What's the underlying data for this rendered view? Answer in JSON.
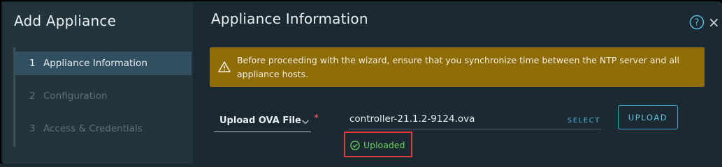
{
  "sidebar": {
    "title": "Add Appliance",
    "steps": [
      {
        "num": "1",
        "label": "Appliance Information"
      },
      {
        "num": "2",
        "label": "Configuration"
      },
      {
        "num": "3",
        "label": "Access & Credentials"
      }
    ]
  },
  "main": {
    "title": "Appliance Information",
    "help_icon": "help-icon",
    "close_label": "×",
    "alert": {
      "icon": "warning-icon",
      "text": "Before proceeding with the wizard, ensure that you synchronize time between the NTP server and all appliance hosts."
    },
    "upload_source": {
      "selected": "Upload OVA File",
      "required_marker": "*"
    },
    "file": {
      "name": "controller-21.1.2-9124.ova",
      "select_label": "SELECT"
    },
    "upload_button": "UPLOAD",
    "status": {
      "icon": "check-circle-icon",
      "text": "Uploaded"
    }
  },
  "colors": {
    "background": "#1b2a32",
    "sidebar": "#22343c",
    "active_step": "#324f61",
    "alert": "#8e6c08",
    "accent": "#4aa6c9",
    "success": "#6fcf5a",
    "highlight_border": "#e23b3b"
  }
}
